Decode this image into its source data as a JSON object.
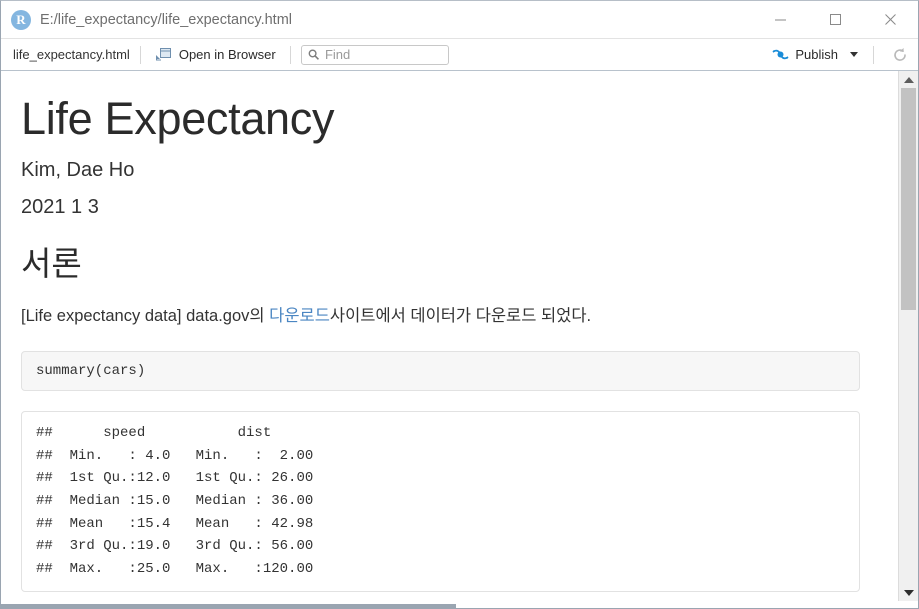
{
  "window": {
    "app_icon_letter": "R",
    "title": "E:/life_expectancy/life_expectancy.html",
    "bg_sliver_text": "■ ■■ ■■■  ■  ■ ■ ■■■■",
    "controls": {
      "minimize": "minimize-button",
      "maximize": "maximize-button",
      "close": "close-button"
    }
  },
  "toolbar": {
    "filename": "life_expectancy.html",
    "open_in_browser_label": "Open in Browser",
    "find_placeholder": "Find",
    "find_value": "",
    "publish_label": "Publish",
    "refresh_label": "Refresh"
  },
  "document": {
    "title": "Life Expectancy",
    "author": "Kim, Dae Ho",
    "date": "2021 1 3",
    "heading1": "서론",
    "paragraph": {
      "before_link": "[Life expectancy data] data.gov의 ",
      "link_text": "다운로드",
      "after_link": "사이트에서 데이터가 다운로드 되었다."
    },
    "code_block": "summary(cars)",
    "output_block": "##      speed           dist\n##  Min.   : 4.0   Min.   :  2.00\n##  1st Qu.:12.0   1st Qu.: 26.00\n##  Median :15.0   Median : 36.00\n##  Mean   :15.4   Mean   : 42.98\n##  3rd Qu.:19.0   3rd Qu.: 56.00\n##  Max.   :25.0   Max.   :120.00"
  },
  "colors": {
    "link": "#4b86c2",
    "publish_icon": "#1a8cd8",
    "app_icon_bg": "#84b6e0",
    "code_bg": "#f7f7f7",
    "scrollbar_thumb": "#c2c2c2"
  },
  "scrollbars": {
    "vertical_up_arrow": "scroll-up",
    "vertical_down_arrow": "scroll-down",
    "vertical_thumb": "vertical-scroll-thumb",
    "horizontal_thumb": "horizontal-scroll-thumb"
  }
}
